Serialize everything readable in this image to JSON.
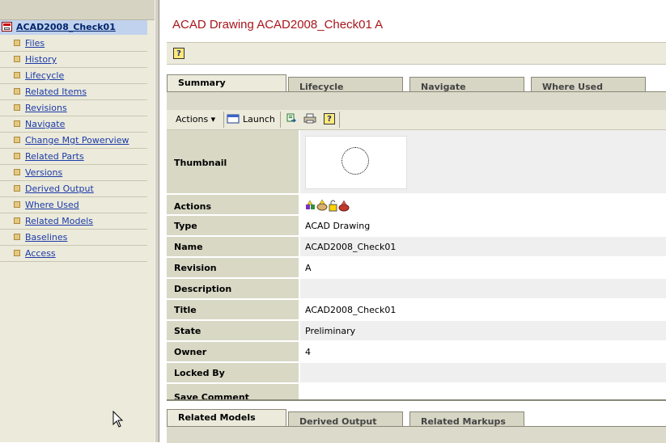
{
  "tree": {
    "root_label": "ACAD2008_Check01",
    "items": [
      {
        "label": "Files"
      },
      {
        "label": "History"
      },
      {
        "label": "Lifecycle"
      },
      {
        "label": "Related Items"
      },
      {
        "label": "Revisions"
      },
      {
        "label": "Navigate"
      },
      {
        "label": "Change Mgt Powerview"
      },
      {
        "label": "Related Parts"
      },
      {
        "label": "Versions"
      },
      {
        "label": "Derived Output"
      },
      {
        "label": "Where Used"
      },
      {
        "label": "Related Models"
      },
      {
        "label": "Baselines"
      },
      {
        "label": "Access"
      }
    ]
  },
  "header": {
    "title": "ACAD Drawing ACAD2008_Check01 A",
    "help_label": "?"
  },
  "tabs": [
    {
      "label": "Summary",
      "active": true
    },
    {
      "label": "Lifecycle",
      "active": false
    },
    {
      "label": "Navigate",
      "active": false
    },
    {
      "label": "Where Used",
      "active": false
    }
  ],
  "toolbar": {
    "actions_label": "Actions ▾",
    "launch_label": "Launch",
    "help_label": "?"
  },
  "properties": [
    {
      "label": "Thumbnail",
      "value": ""
    },
    {
      "label": "Actions",
      "value": ""
    },
    {
      "label": "Type",
      "value": "ACAD Drawing"
    },
    {
      "label": "Name",
      "value": "ACAD2008_Check01"
    },
    {
      "label": "Revision",
      "value": "A"
    },
    {
      "label": "Description",
      "value": ""
    },
    {
      "label": "Title",
      "value": "ACAD2008_Check01"
    },
    {
      "label": "State",
      "value": "Preliminary"
    },
    {
      "label": "Owner",
      "value": "4"
    },
    {
      "label": "Locked By",
      "value": ""
    },
    {
      "label": "Save Comment",
      "value": ""
    }
  ],
  "bottom_tabs": [
    {
      "label": "Related Models",
      "active": true
    },
    {
      "label": "Derived Output",
      "active": false
    },
    {
      "label": "Related Markups",
      "active": false
    }
  ],
  "colors": {
    "title": "#a8151b",
    "link": "#1c3aa8",
    "panel": "#ebeadb",
    "label_cell": "#d9d8c5"
  }
}
